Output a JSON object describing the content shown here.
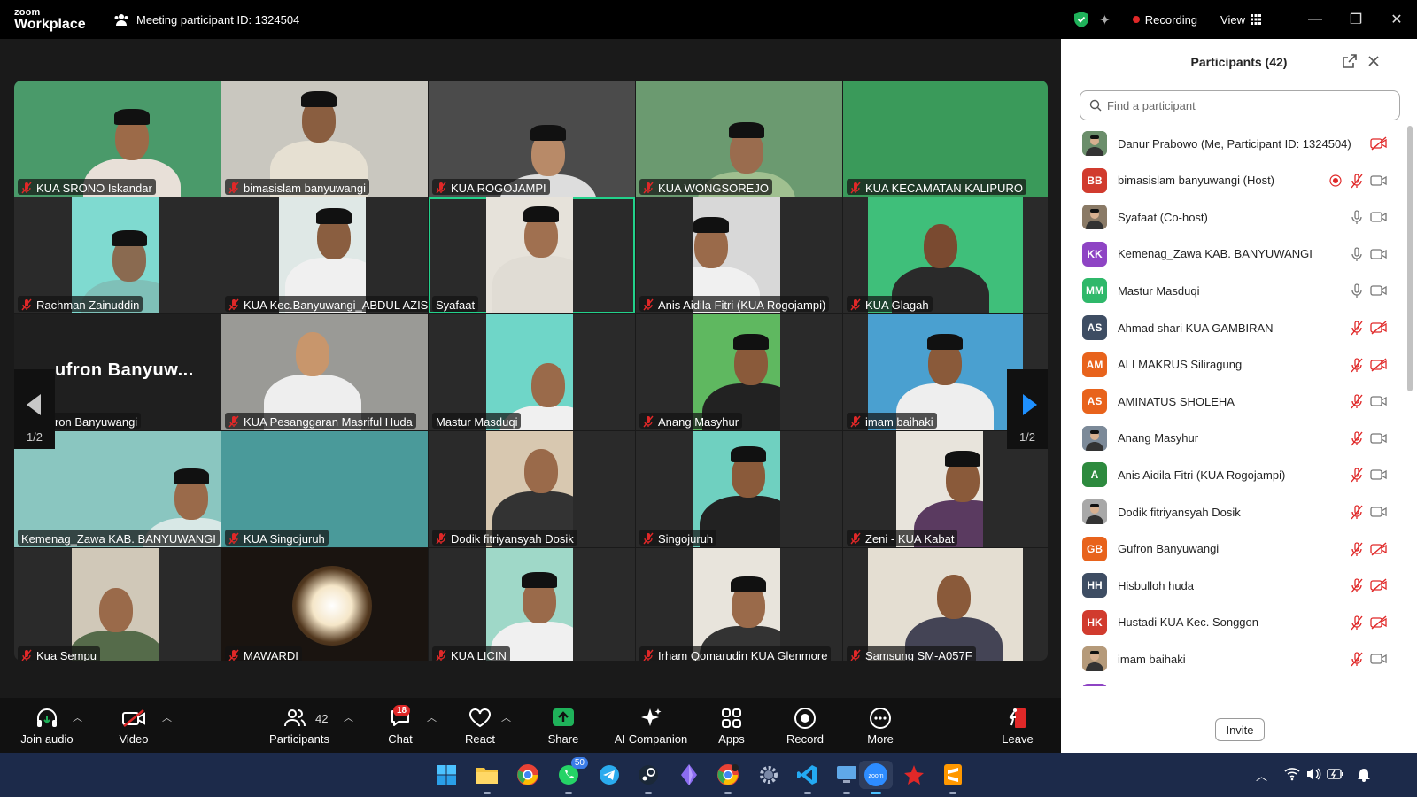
{
  "app": {
    "logo_line1": "zoom",
    "logo_line2": "Workplace",
    "meeting_label": "Meeting participant ID: 1324504"
  },
  "titlebar": {
    "recording_label": "Recording",
    "view_label": "View"
  },
  "gallery": {
    "tiles": [
      {
        "name": "KUA SRONO Iskandar"
      },
      {
        "name": "bimasislam banyuwangi"
      },
      {
        "name": "KUA ROGOJAMPI"
      },
      {
        "name": "KUA WONGSOREJO"
      },
      {
        "name": "KUA KECAMATAN KALIPURO"
      },
      {
        "name": "Rachman Zainuddin"
      },
      {
        "name": "KUA Kec.Banyuwangi_ABDUL AZIS"
      },
      {
        "name": "Syafaat"
      },
      {
        "name": "Anis Aidila Fitri (KUA Rogojampi)"
      },
      {
        "name": "KUA Glagah"
      },
      {
        "name": "Gufron Banyuwangi"
      },
      {
        "name": "KUA Pesanggaran Masriful Huda"
      },
      {
        "name": "Mastur Masduqi"
      },
      {
        "name": "Anang Masyhur"
      },
      {
        "name": "imam baihaki"
      },
      {
        "name": "Kemenag_Zawa KAB. BANYUWANGI"
      },
      {
        "name": "KUA Singojuruh"
      },
      {
        "name": "Dodik fitriyansyah Dosik"
      },
      {
        "name": "Singojuruh"
      },
      {
        "name": "Zeni - KUA Kabat"
      },
      {
        "name": "Kua Sempu"
      },
      {
        "name": "MAWARDI"
      },
      {
        "name": "KUA LICIN"
      },
      {
        "name": "Irham Qomarudin KUA Glenmore"
      },
      {
        "name": "Samsung SM-A057F"
      }
    ],
    "big_name_text": "ufron  Banyuw...",
    "page_left": "1/2",
    "page_right": "1/2"
  },
  "toolbar": {
    "join_audio": "Join audio",
    "video": "Video",
    "participants": "Participants",
    "participants_count": "42",
    "chat": "Chat",
    "chat_badge": "18",
    "react": "React",
    "share": "Share",
    "ai_companion": "AI Companion",
    "apps": "Apps",
    "record": "Record",
    "more": "More",
    "leave": "Leave"
  },
  "panel": {
    "title": "Participants (42)",
    "search_placeholder": "Find a participant",
    "invite_label": "Invite",
    "participants": [
      {
        "initials": "",
        "name": "Danur Prabowo (Me, Participant ID: 1324504)",
        "color": "#6b8e6b"
      },
      {
        "initials": "BB",
        "name": "bimasislam banyuwangi (Host)",
        "color": "#d13b2e"
      },
      {
        "initials": "",
        "name": "Syafaat (Co-host)",
        "color": "#8a7a66"
      },
      {
        "initials": "KK",
        "name": "Kemenag_Zawa KAB. BANYUWANGI",
        "color": "#8e44c4"
      },
      {
        "initials": "MM",
        "name": "Mastur Masduqi",
        "color": "#2fb86a"
      },
      {
        "initials": "AS",
        "name": "Ahmad shari KUA GAMBIRAN",
        "color": "#3e4d63"
      },
      {
        "initials": "AM",
        "name": "ALI MAKRUS Siliragung",
        "color": "#e8631c"
      },
      {
        "initials": "AS",
        "name": "AMINATUS SHOLEHA",
        "color": "#e8631c"
      },
      {
        "initials": "",
        "name": "Anang Masyhur",
        "color": "#7c8a99"
      },
      {
        "initials": "A",
        "name": "Anis Aidila Fitri (KUA Rogojampi)",
        "color": "#2d8a3e"
      },
      {
        "initials": "",
        "name": "Dodik fitriyansyah Dosik",
        "color": "#a8a8a8"
      },
      {
        "initials": "GB",
        "name": "Gufron Banyuwangi",
        "color": "#e8631c"
      },
      {
        "initials": "HH",
        "name": "Hisbulloh huda",
        "color": "#3e4d63"
      },
      {
        "initials": "HK",
        "name": "Hustadi KUA Kec. Songgon",
        "color": "#d13b2e"
      },
      {
        "initials": "",
        "name": "imam baihaki",
        "color": "#b59a7a"
      }
    ]
  },
  "taskbar": {
    "whatsapp_badge": "50"
  }
}
